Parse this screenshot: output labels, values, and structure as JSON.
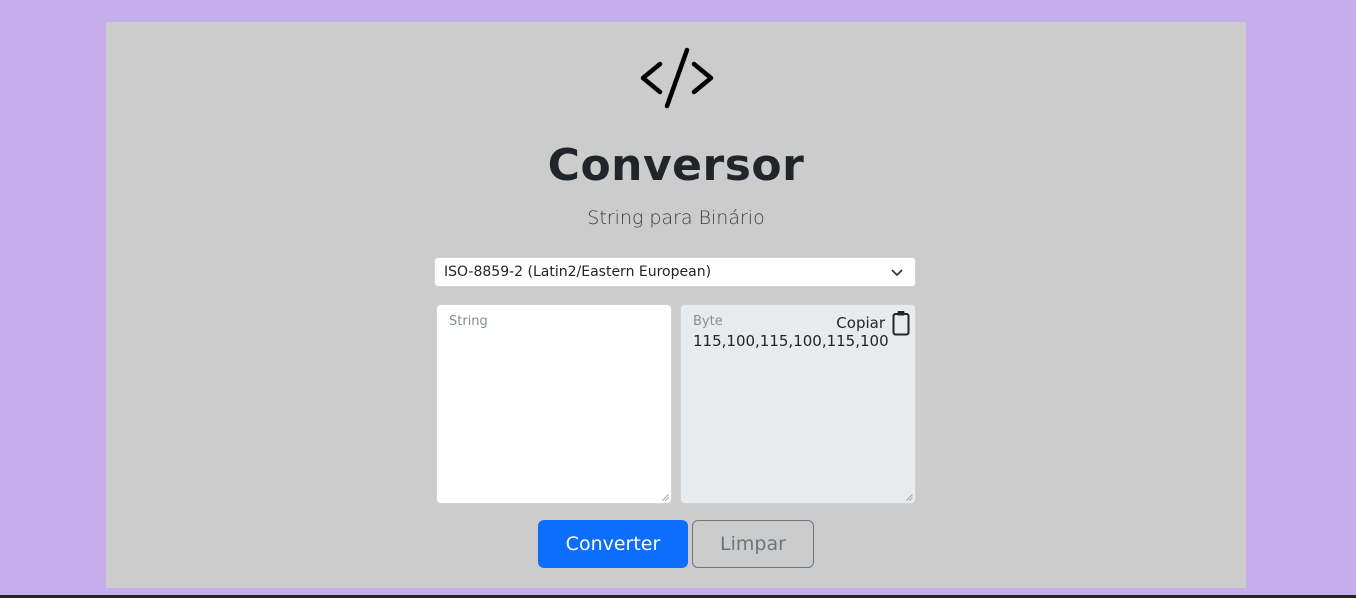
{
  "header": {
    "logo_icon": "code-icon",
    "title": "Conversor",
    "subtitle": "String para Binário"
  },
  "encoding_select": {
    "selected": "ISO-8859-2 (Latin2/Eastern European)",
    "icon": "chevron-down-icon"
  },
  "input": {
    "placeholder": "String",
    "value": ""
  },
  "output": {
    "placeholder": "Byte",
    "value": "115,100,115,100,115,100",
    "copy_label": "Copiar",
    "copy_icon": "clipboard-icon"
  },
  "actions": {
    "convert_label": "Converter",
    "clear_label": "Limpar"
  },
  "colors": {
    "page_background": "#c5aeeb",
    "panel_background": "#cccccc",
    "primary": "#0d6efd",
    "secondary": "#6c757d",
    "output_background": "#e8ebee"
  }
}
